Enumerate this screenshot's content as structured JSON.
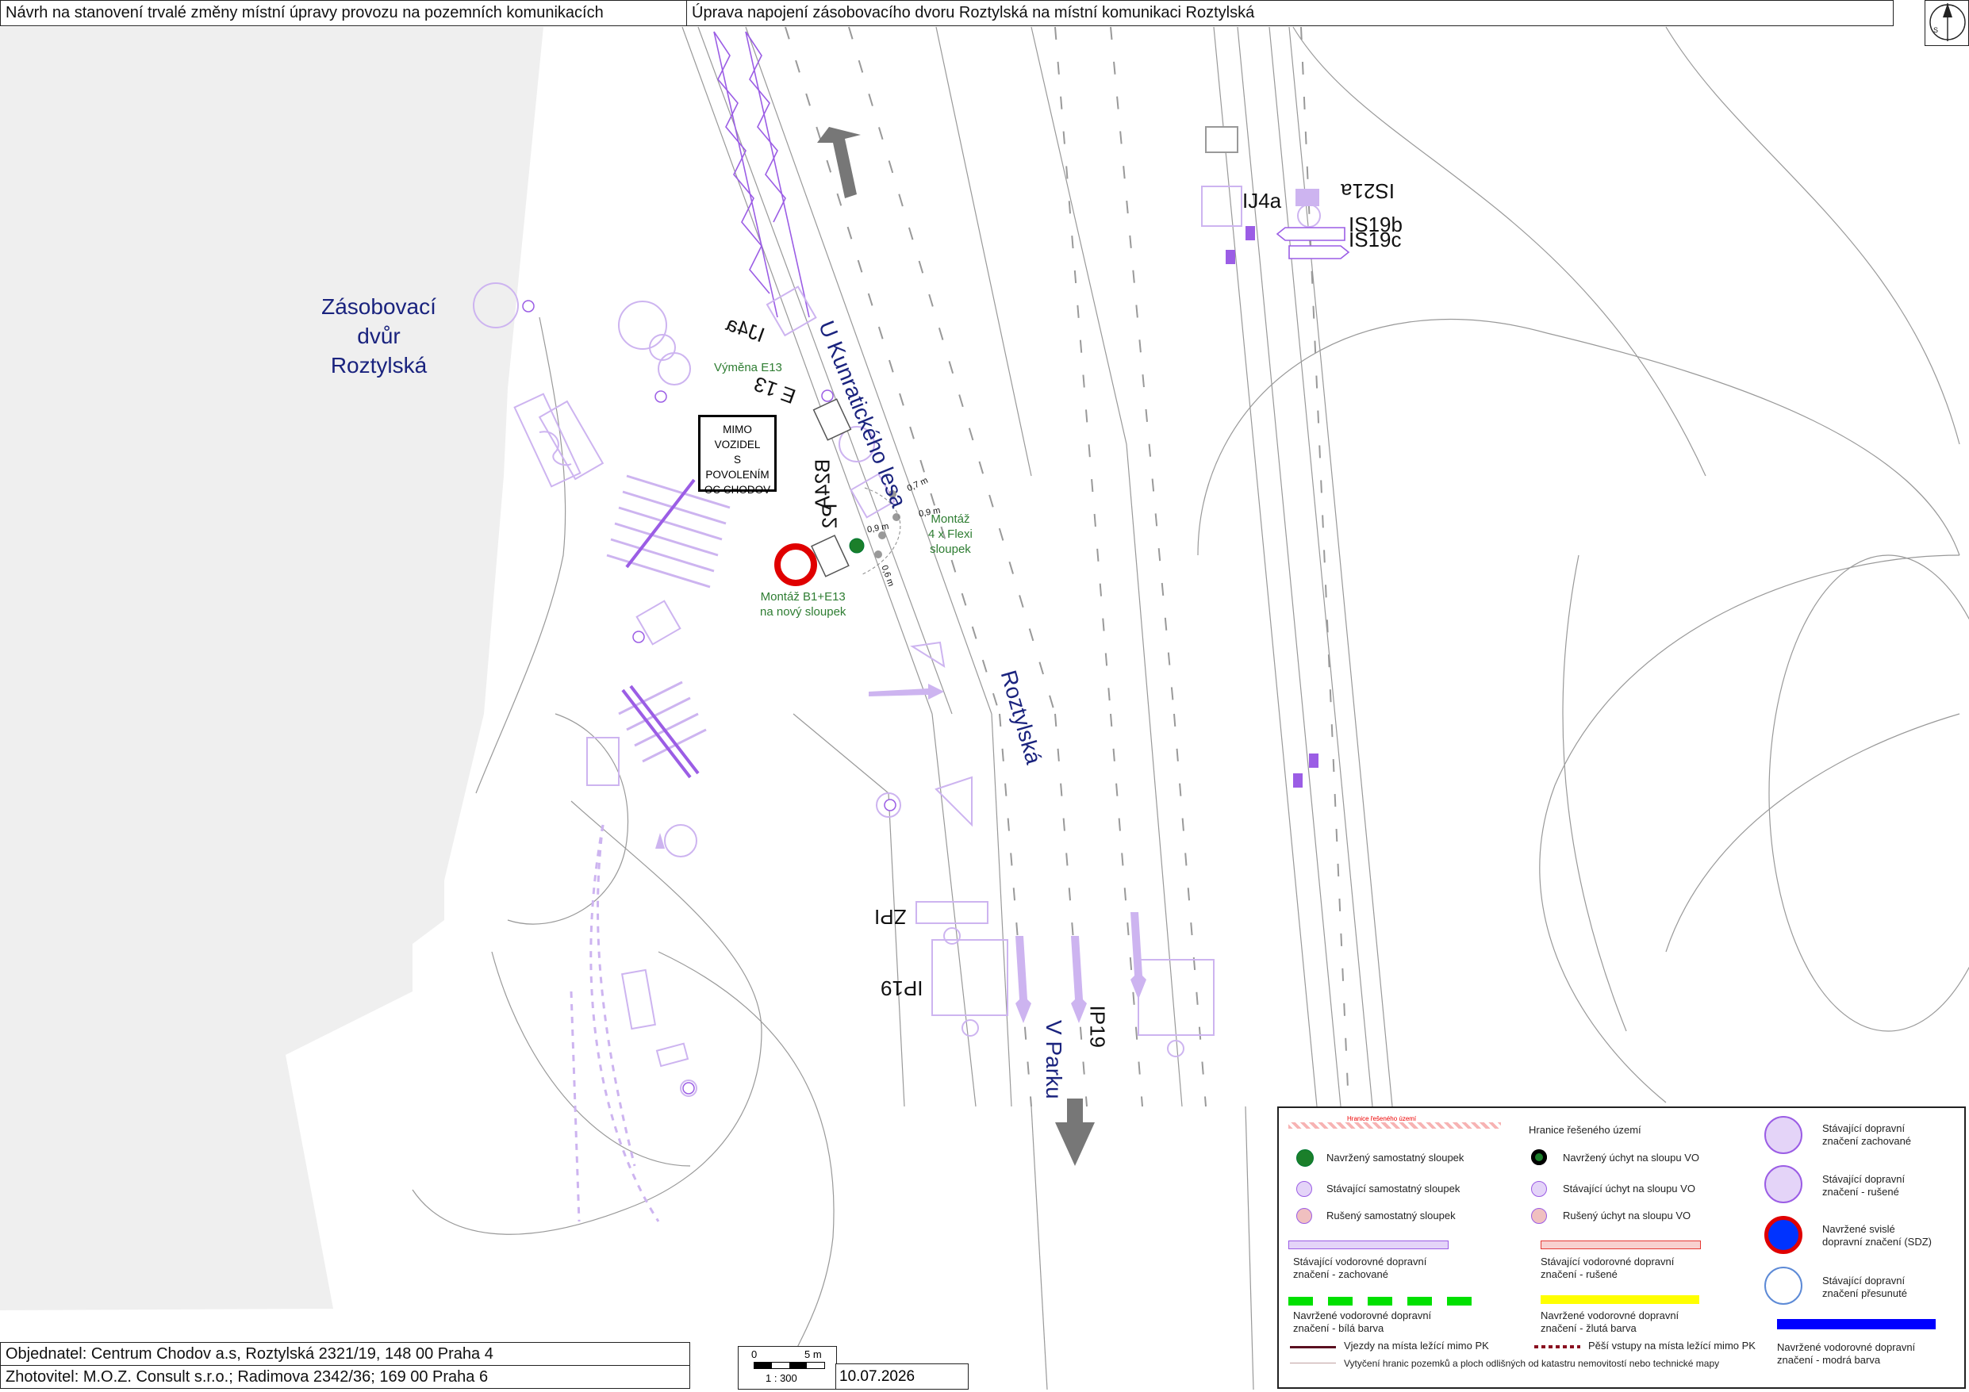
{
  "header": {
    "left_title": "Návrh na stanovení trvalé změny místní úpravy provozu na pozemních komunikacích",
    "right_title": "Úprava napojení zásobovacího dvoru Roztylská na místní komunikaci Roztylská",
    "compass_letters": "S"
  },
  "labels": {
    "yard_line1": "Zásobovací",
    "yard_line2": "dvůr",
    "yard_line3": "Roztylská",
    "street_u_kunratickeho": "U Kunratického lesa",
    "street_roztylska": "Roztylská",
    "street_v_parku": "V Parku",
    "sign_ij4a_left": "IJ4a",
    "sign_ij4a_right": "IJ4a",
    "sign_e13": "E 13",
    "sign_b24a": "B24A",
    "sign_p2": "P2",
    "sign_is21a": "IS21a",
    "sign_is19b": "IS19b",
    "sign_is19c": "IS19c",
    "sign_zpi": "ZPI",
    "sign_ip19_left": "IP19",
    "sign_ip19_right": "IP19",
    "note_vymena": "Výměna E13",
    "note_montaz_flexi": [
      "Montáž",
      "4 x Flexi",
      "sloupek"
    ],
    "note_montaz_b1": [
      "Montáž B1+E13",
      "na nový sloupek"
    ],
    "plate_text": [
      "MIMO",
      "VOZIDEL",
      "S POVOLENÍM",
      "OC CHODOV"
    ],
    "dist_07": "0,7 m",
    "dist_09a": "0,9 m",
    "dist_09b": "0,9 m",
    "dist_06": "0,6 m"
  },
  "footer": {
    "client": "Objednatel: Centrum Chodov a.s, Roztylská 2321/19, 148 00 Praha 4",
    "contractor": "Zhotovitel: M.O.Z. Consult s.r.o.; Radimova 2342/36; 169 00 Praha 6",
    "scale_zero": "0",
    "scale_five": "5 m",
    "scale_ratio": "1 : 300",
    "date": "10.07.2026"
  },
  "legend": {
    "boundary_small": "Hranice řešeného území",
    "boundary_label": "Hranice řešeného území",
    "new_post": "Navržený samostatný sloupek",
    "new_mount_vo": "Navržený úchyt na sloupu VO",
    "existing_post": "Stávající samostatný sloupek",
    "existing_mount_vo": "Stávající úchyt na sloupu VO",
    "cancelled_post": "Rušený samostatný sloupek",
    "cancelled_mount_vo": "Rušený úchyt na sloupu VO",
    "existing_kept": [
      "Stávající dopravní",
      "značení zachované"
    ],
    "existing_cancelled": [
      "Stávající dopravní",
      "značení - rušené"
    ],
    "new_vertical": [
      "Navržené svislé",
      "dopravní značení (SDZ)"
    ],
    "existing_moved": [
      "Stávající dopravní",
      "značení přesunuté"
    ],
    "horiz_kept": [
      "Stávající vodorovné dopravní",
      "značení - zachované"
    ],
    "horiz_cancelled": [
      "Stávající vodorovné dopravní",
      "značení - rušené"
    ],
    "horiz_white": [
      "Navržené vodorovné dopravní",
      "značení - bílá barva"
    ],
    "horiz_yellow": [
      "Navržené vodorovné dopravní",
      "značení - žlutá barva"
    ],
    "horiz_blue": [
      "Navržené vodorovné dopravní",
      "značení - modrá barva"
    ],
    "entry_outside": "Vjezdy na místa ležící mimo PK",
    "ped_outside": "Pěší vstupy na místa ležící mimo PK",
    "parcel_boundary": "Vytyčení hranic pozemků a ploch odlišných od katastru nemovitostí nebo technické mapy"
  },
  "colors": {
    "purple": "#9b5de5",
    "purple_light": "#cdb4f0",
    "street_label": "#1a237e",
    "note_green": "#2e7d32",
    "sign_red": "#e00000",
    "legend_green": "#00e000",
    "legend_yellow": "#ffff00",
    "legend_blue": "#0000ff",
    "legend_red": "#e53935",
    "gray_area": "#efefef"
  }
}
